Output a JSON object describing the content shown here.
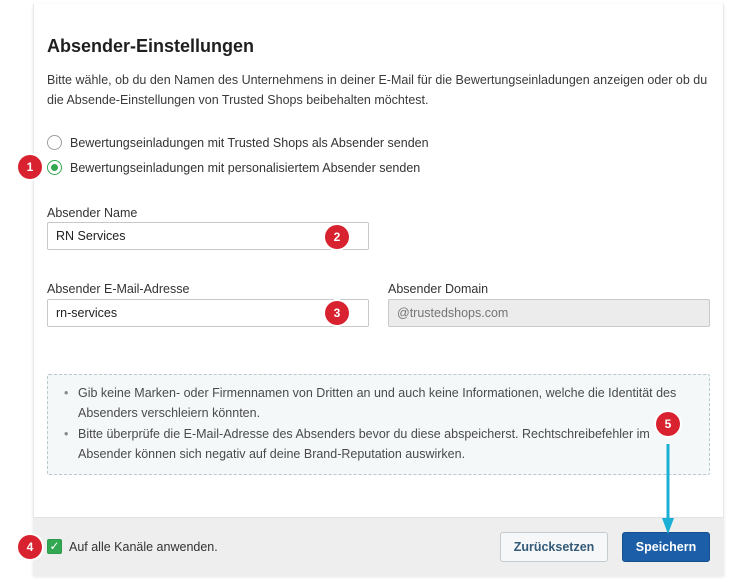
{
  "title": "Absender-Einstellungen",
  "description": "Bitte wähle, ob du den Namen des Unternehmens in deiner E-Mail für die Bewertungseinladungen anzeigen oder ob du die Absende-Einstellungen von Trusted Shops beibehalten möchtest.",
  "sender_options": [
    {
      "label": "Bewertungseinladungen mit Trusted Shops als Absender senden",
      "selected": false
    },
    {
      "label": "Bewertungseinladungen mit personalisiertem Absender senden",
      "selected": true
    }
  ],
  "sender_name": {
    "label": "Absender Name",
    "value": "RN Services"
  },
  "sender_email": {
    "label": "Absender E-Mail-Adresse",
    "value": "rn-services"
  },
  "sender_domain": {
    "label": "Absender Domain",
    "placeholder": "@trustedshops.com"
  },
  "info": [
    "Gib keine Marken- oder Firmennamen von Dritten an und auch keine Informationen, welche die Identität des Absenders verschleiern könnten.",
    "Bitte überprüfe die E-Mail-Adresse des Absenders bevor du diese abspeicherst. Rechtschreibefehler im Absender können sich negativ auf deine Brand-Reputation auswirken."
  ],
  "apply_all": {
    "label": "Auf alle Kanäle anwenden.",
    "checked": true
  },
  "buttons": {
    "reset": "Zurücksetzen",
    "save": "Speichern"
  },
  "badges": [
    "1",
    "2",
    "3",
    "4",
    "5"
  ],
  "colors": {
    "accent_green": "#33a852",
    "primary_blue": "#1c5fa8",
    "badge_red": "#d8222f",
    "arrow_cyan": "#1ab0d6"
  }
}
